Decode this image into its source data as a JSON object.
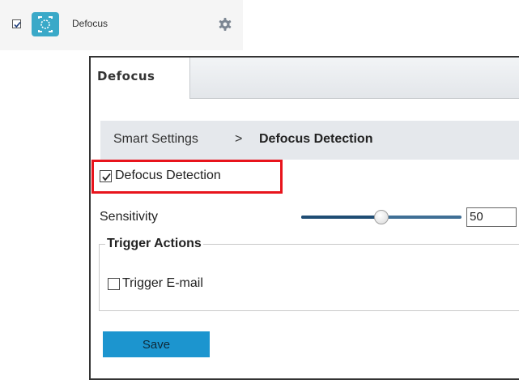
{
  "feature_row": {
    "label": "Defocus",
    "enabled": true,
    "icon": "defocus-camera-icon",
    "settings_icon": "gear-icon",
    "accent_color": "#3aa9c8"
  },
  "panel": {
    "tab_label": "Defocus",
    "breadcrumb": {
      "parent": "Smart Settings",
      "separator": ">",
      "current": "Defocus Detection"
    },
    "detection_checkbox": {
      "label": "Defocus Detection",
      "checked": true,
      "highlight_color": "#e8141c"
    },
    "sensitivity": {
      "label": "Sensitivity",
      "value": "50",
      "min": 0,
      "max": 100
    },
    "trigger_actions": {
      "title": "Trigger Actions",
      "email": {
        "label": "Trigger E-mail",
        "checked": false
      }
    },
    "save_label": "Save",
    "save_color": "#1c95cf"
  }
}
